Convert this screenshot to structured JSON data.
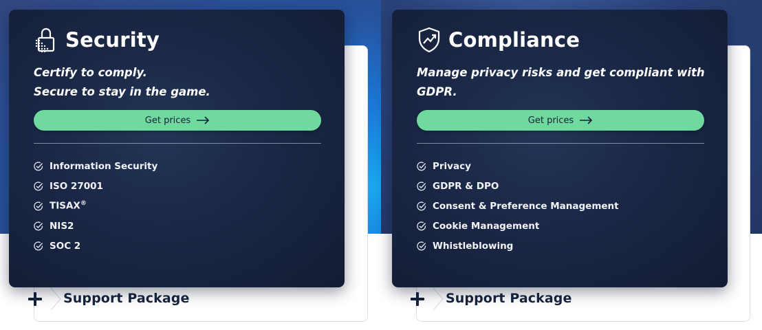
{
  "colors": {
    "card_background": "#1a2745",
    "cta_green": "#6fd9a0",
    "panel_text": "#17243f",
    "hero_blue": "#1b78d8"
  },
  "cards": [
    {
      "title": "Security",
      "icon": "padlock-icon",
      "tagline_line1": "Certify to comply.",
      "tagline_line2": "Secure to stay in the game.",
      "cta_label": "Get prices",
      "features": [
        {
          "label": "Information Security",
          "sup": ""
        },
        {
          "label": "ISO 27001",
          "sup": ""
        },
        {
          "label": "TISAX",
          "sup": "®"
        },
        {
          "label": "NIS2",
          "sup": ""
        },
        {
          "label": "SOC 2",
          "sup": ""
        }
      ],
      "support_label": "Support Package"
    },
    {
      "title": "Compliance",
      "icon": "shield-trend-icon",
      "tagline_line1": "Manage privacy risks and get compliant with",
      "tagline_line2": "GDPR.",
      "cta_label": "Get prices",
      "features": [
        {
          "label": "Privacy",
          "sup": ""
        },
        {
          "label": "GDPR & DPO",
          "sup": ""
        },
        {
          "label": "Consent & Preference Management",
          "sup": ""
        },
        {
          "label": "Cookie Management",
          "sup": ""
        },
        {
          "label": "Whistleblowing",
          "sup": ""
        }
      ],
      "support_label": "Support Package"
    }
  ]
}
